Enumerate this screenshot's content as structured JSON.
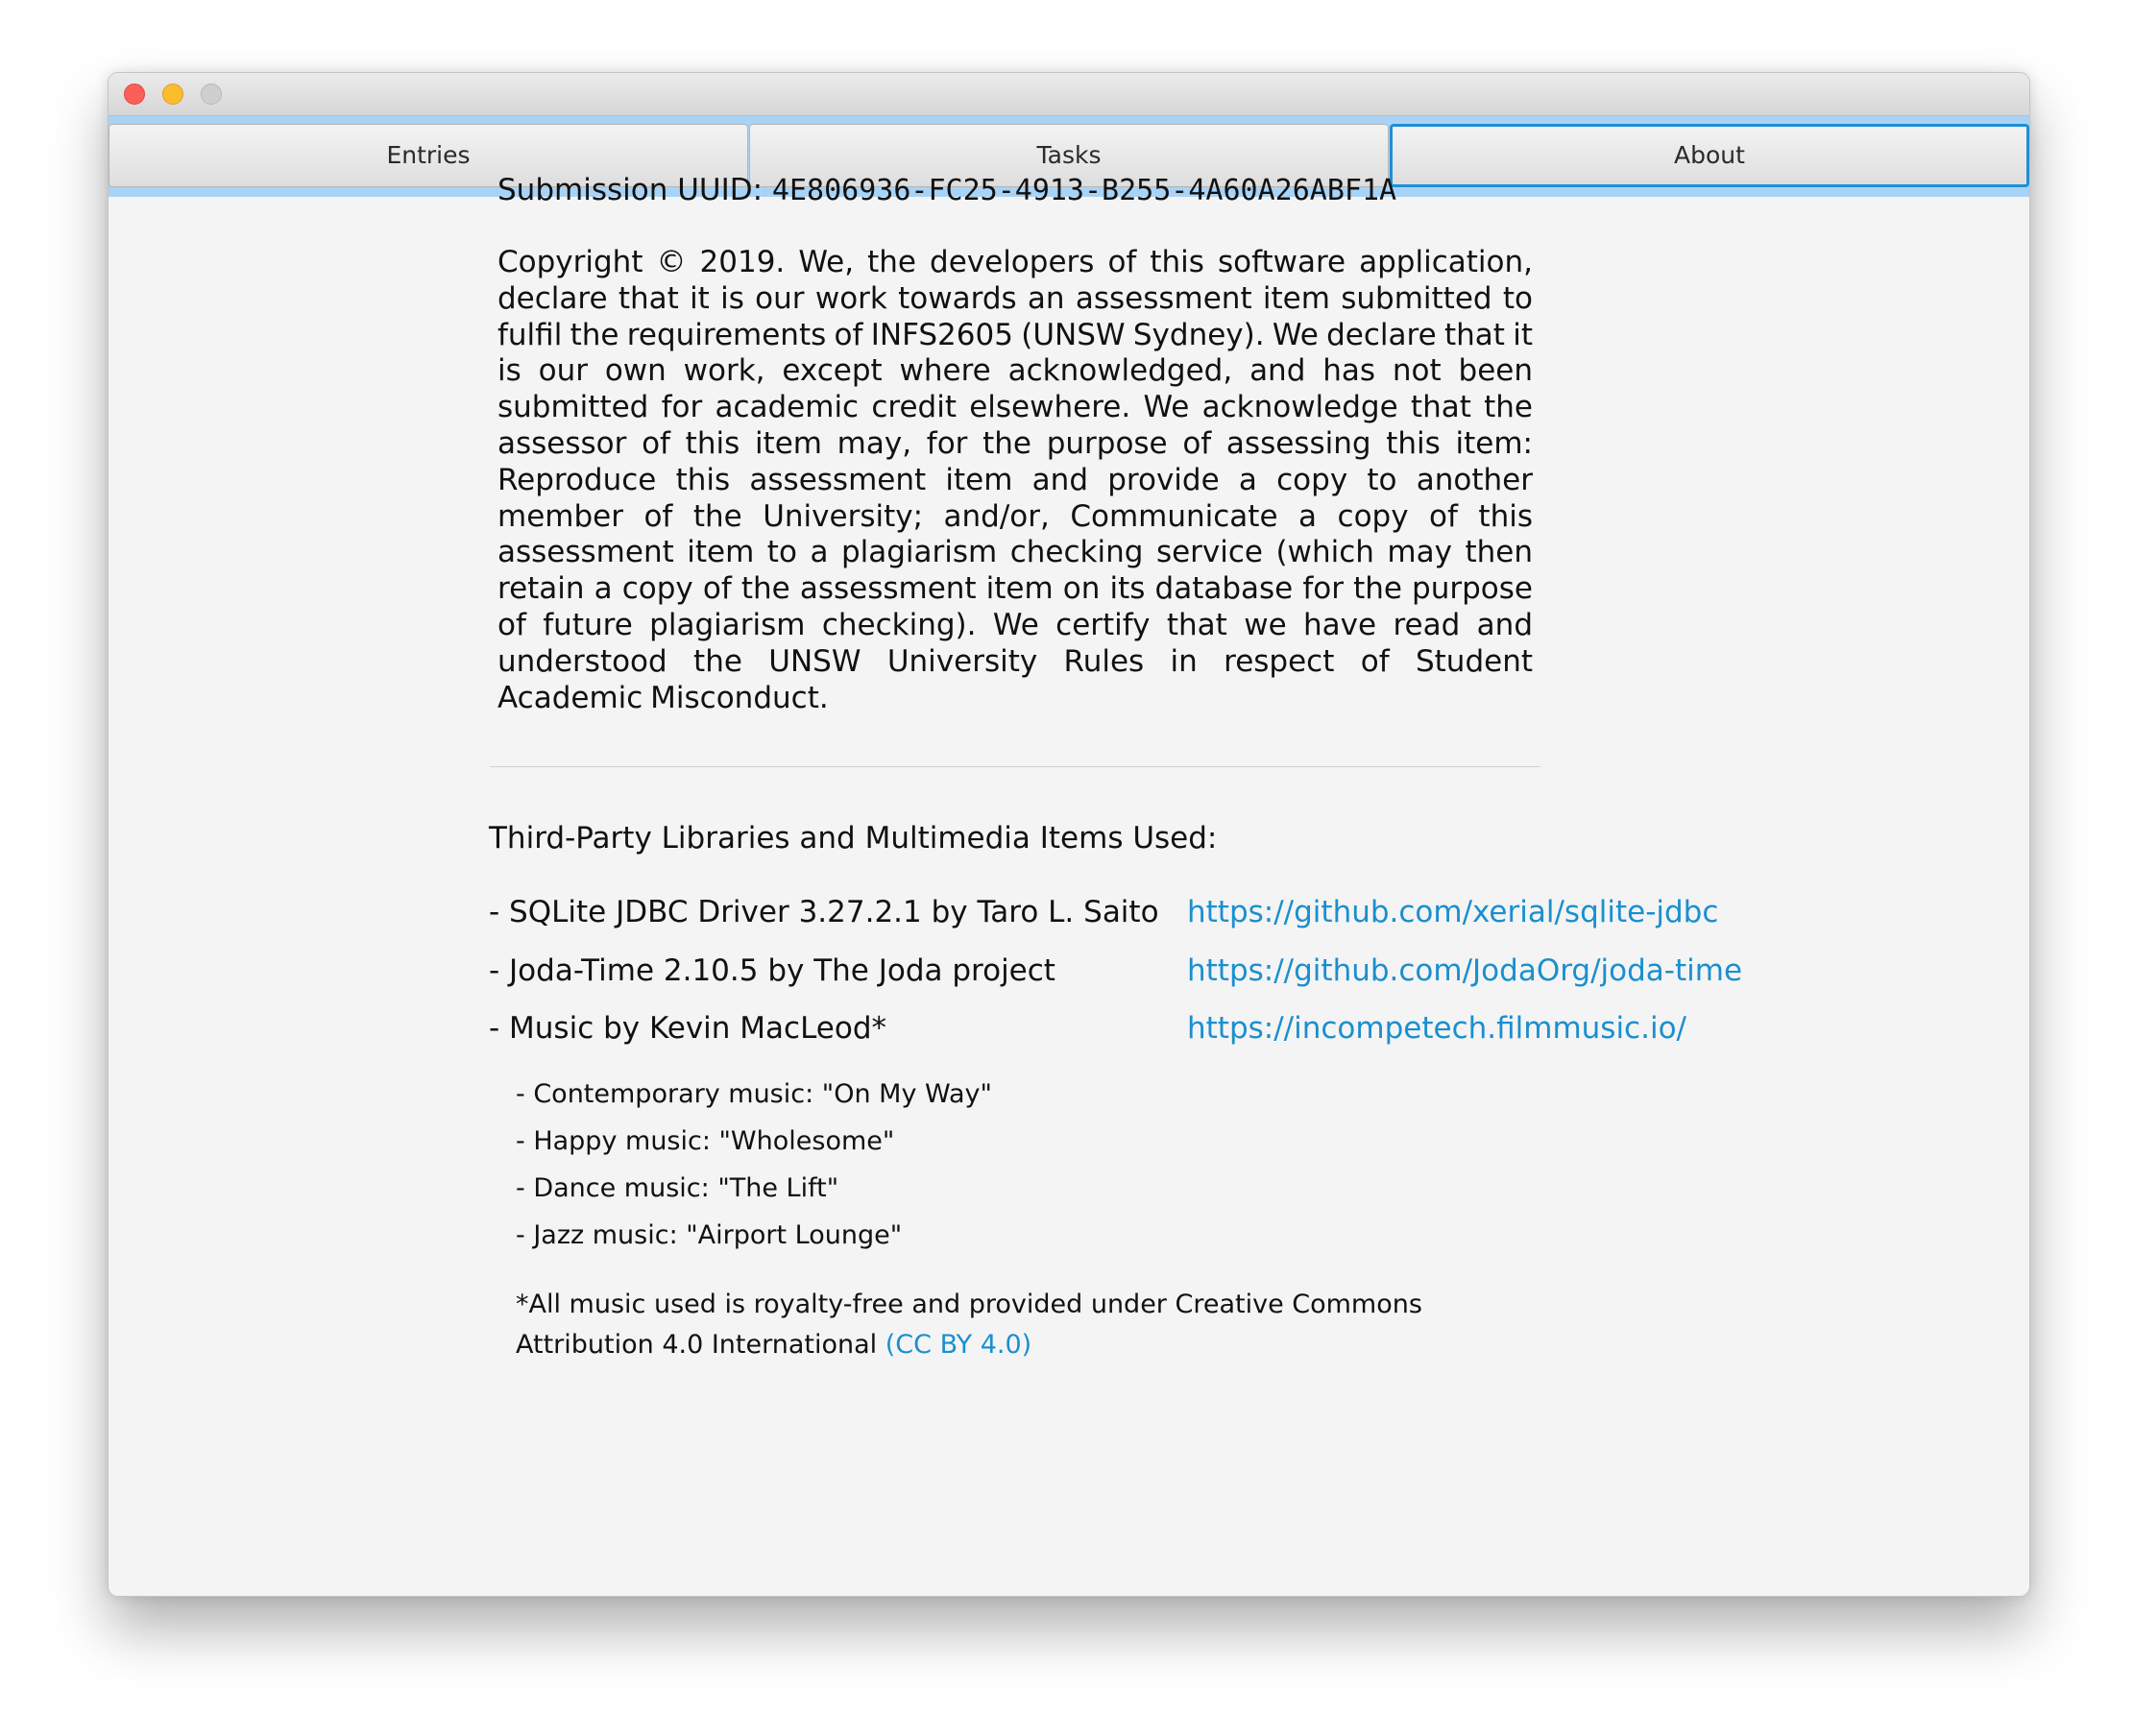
{
  "window": {
    "controls": {
      "close_icon": "close-icon",
      "minimize_icon": "minimize-icon",
      "zoom_icon": "zoom-icon"
    }
  },
  "tabs": [
    {
      "label": "Entries",
      "selected": false
    },
    {
      "label": "Tasks",
      "selected": false
    },
    {
      "label": "About",
      "selected": true
    }
  ],
  "about": {
    "uuid_label": "Submission UUID: ",
    "uuid_value": "4E806936-FC25-4913-B255-4A60A26ABF1A",
    "declaration": "Copyright © 2019. We, the developers of this software application, declare that it is our work towards an assessment item submitted to fulfil the requirements of INFS2605 (UNSW Sydney). We declare that it is our own work, except where acknowledged, and has not been submitted for academic credit elsewhere. We acknowledge that the assessor of this item may, for the purpose of assessing this item: Reproduce this assessment item and provide a copy to another member of the University; and/or, Communicate a copy of this assessment item to a plagiarism checking service (which may then retain a copy of the assessment item on its database for the purpose of future plagiarism checking). We certify that we have read and understood the UNSW University Rules in respect of Student Academic Misconduct.",
    "libraries_heading": "Third-Party Libraries and Multimedia Items Used:",
    "libraries": [
      {
        "name": "- SQLite JDBC Driver 3.27.2.1 by Taro L. Saito",
        "link": "https://github.com/xerial/sqlite-jdbc"
      },
      {
        "name": "- Joda-Time 2.10.5 by The Joda project",
        "link": "https://github.com/JodaOrg/joda-time"
      },
      {
        "name": "- Music by Kevin MacLeod*",
        "link": "https://incompetech.filmmusic.io/"
      }
    ],
    "tracks": [
      "- Contemporary music: \"On My Way\"",
      "- Happy music: \"Wholesome\"",
      "- Dance music: \"The Lift\"",
      "- Jazz music: \"Airport Lounge\""
    ],
    "license_line1": "*All music used is royalty-free and provided under Creative Commons",
    "license_line2": "Attribution 4.0 International ",
    "license_link": "(CC BY 4.0)"
  },
  "colors": {
    "tab_strip": "#a8d3f7",
    "selected_tab_border": "#1d8fd6",
    "link": "#1a8fcf",
    "background": "#f4f4f4"
  }
}
